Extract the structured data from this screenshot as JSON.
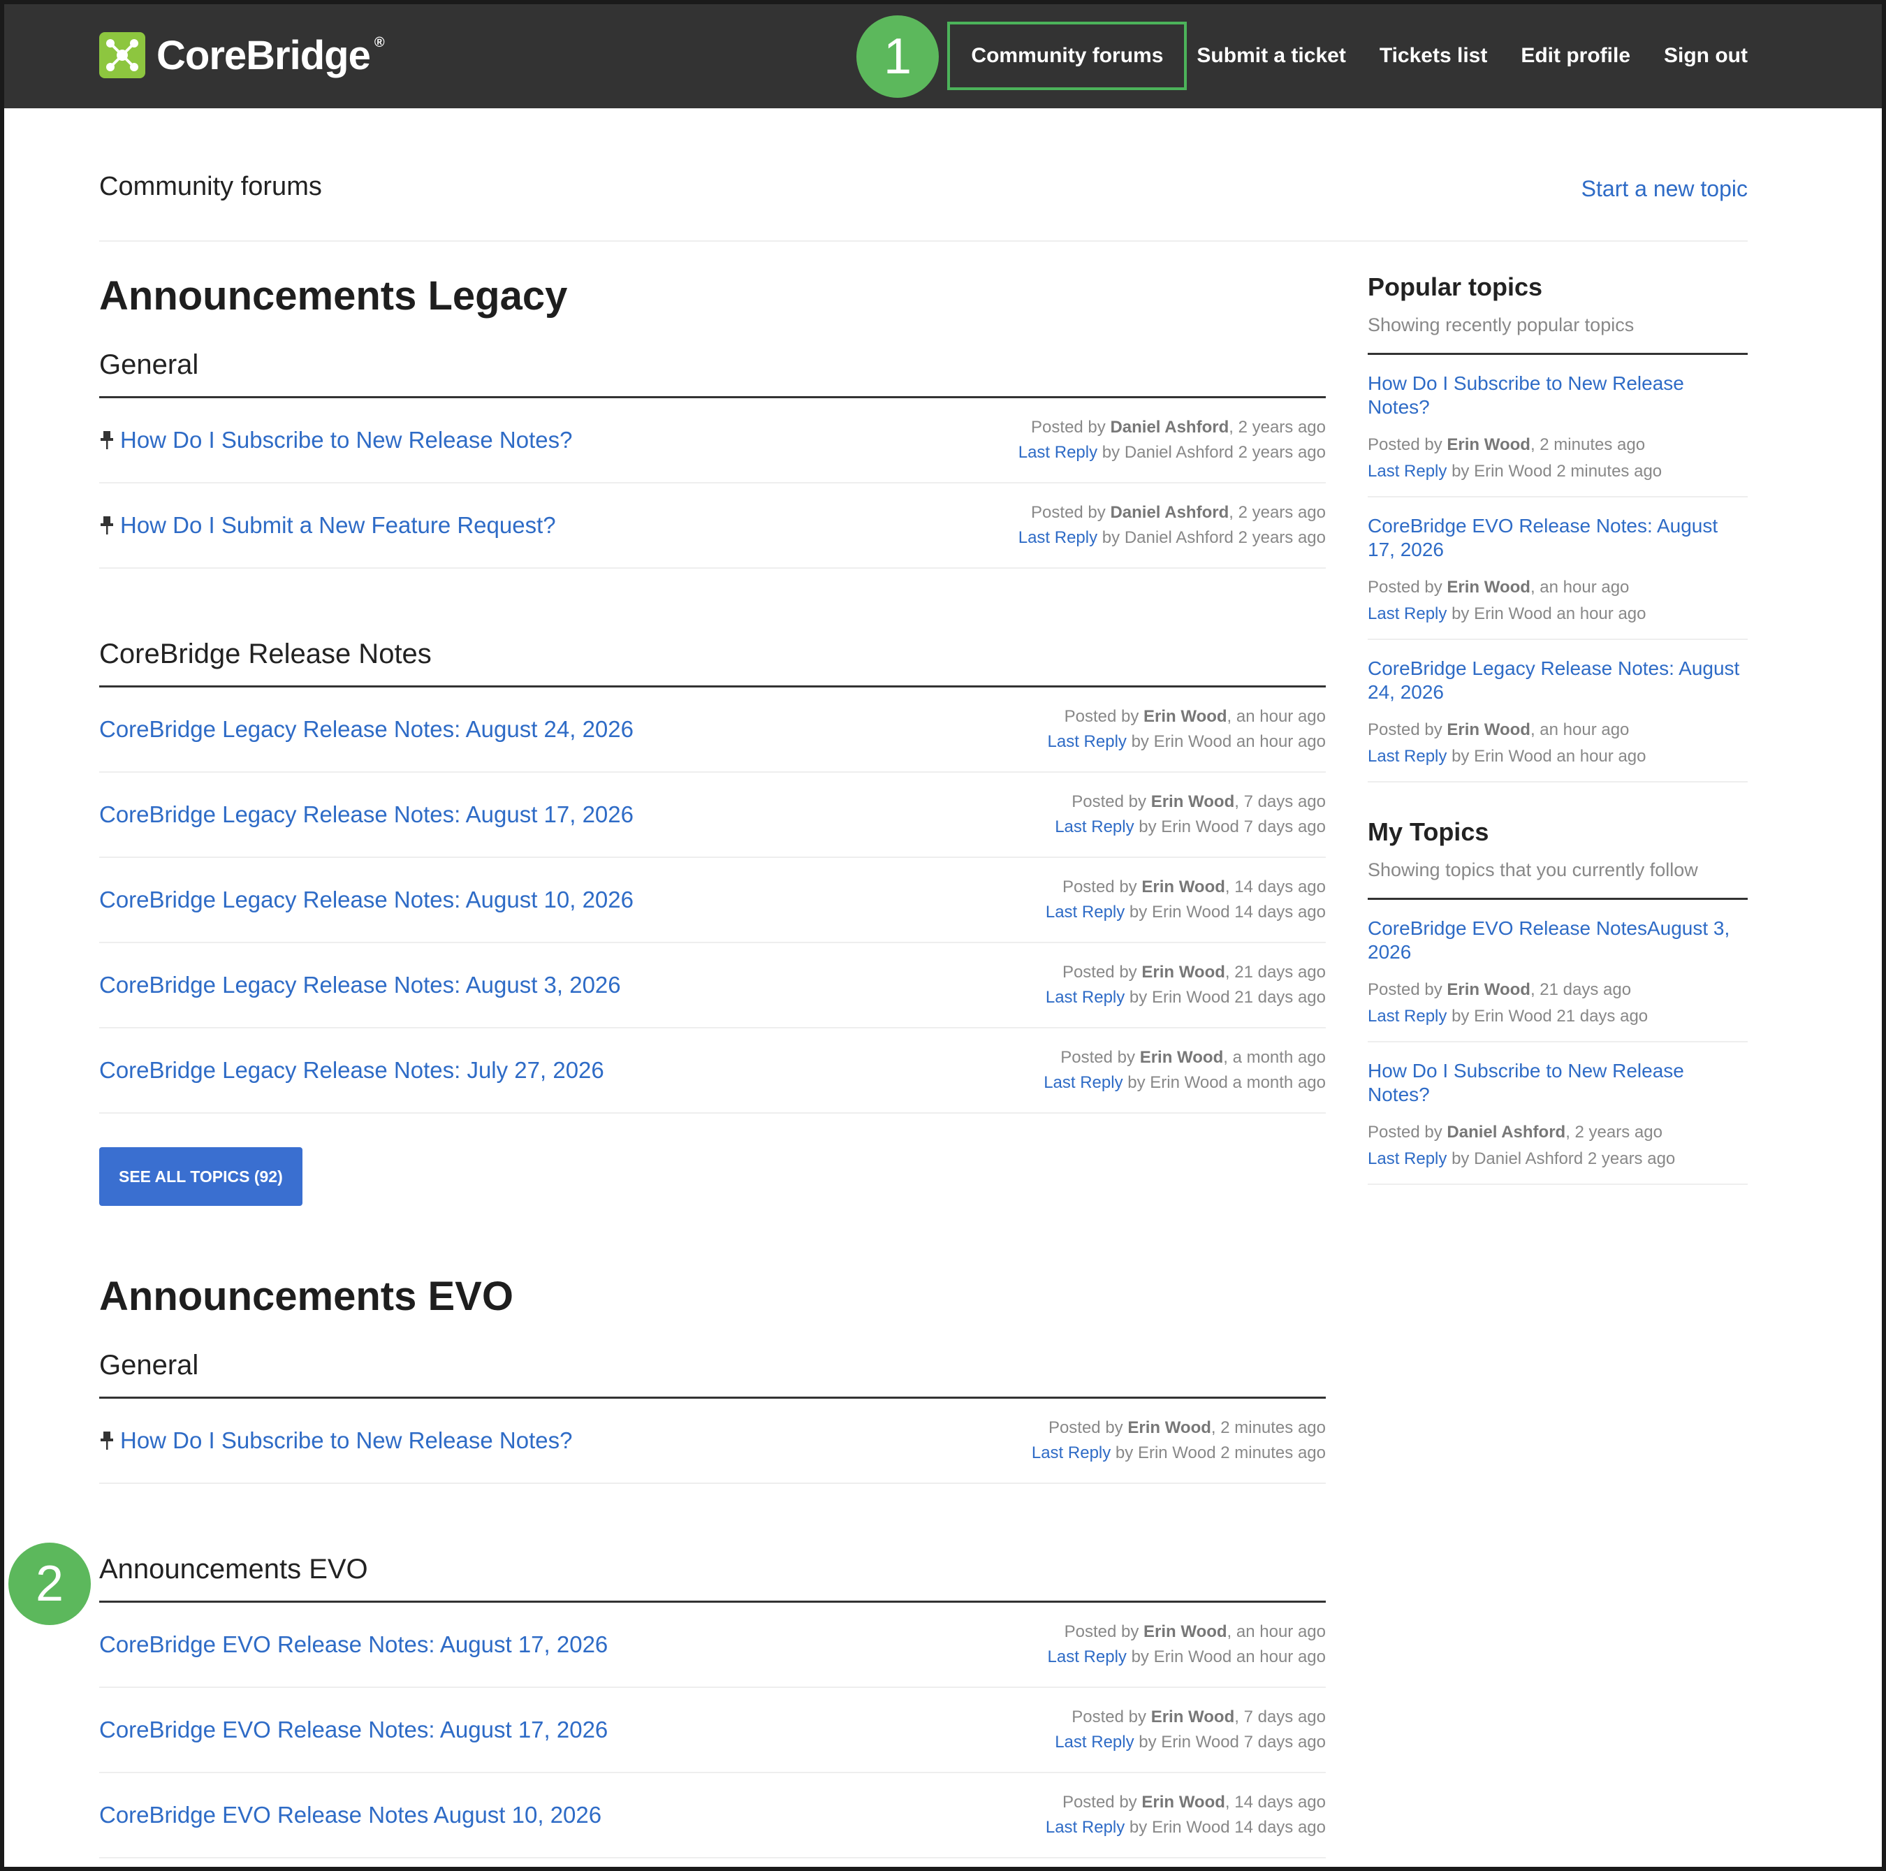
{
  "brand": {
    "name": "CoreBridge",
    "reg": "®",
    "accent": "#8dc63f"
  },
  "nav": {
    "items": [
      "Community forums",
      "Submit a ticket",
      "Tickets list",
      "Edit profile",
      "Sign out"
    ]
  },
  "callouts": [
    "1",
    "2"
  ],
  "page": {
    "title": "Community forums",
    "new_topic": "Start a new topic"
  },
  "labels": {
    "posted_by": "Posted by",
    "last_reply": "Last Reply",
    "by": "by"
  },
  "sections": [
    {
      "title": "Announcements Legacy",
      "categories": [
        {
          "title": "General",
          "rows": [
            {
              "pinned": true,
              "title": "How Do I Subscribe to New Release Notes?",
              "author": "Daniel Ashford",
              "posted": ", 2 years ago",
              "reply": "Daniel Ashford 2 years ago"
            },
            {
              "pinned": true,
              "title": "How Do I Submit a New Feature Request?",
              "author": "Daniel Ashford",
              "posted": ", 2 years ago",
              "reply": "Daniel Ashford 2 years ago"
            }
          ]
        },
        {
          "title": "CoreBridge Release Notes",
          "rows": [
            {
              "pinned": false,
              "title": "CoreBridge Legacy Release Notes: August 24, 2026",
              "author": "Erin Wood",
              "posted": ", an hour ago",
              "reply": "Erin Wood an hour ago"
            },
            {
              "pinned": false,
              "title": "CoreBridge Legacy Release Notes: August 17, 2026",
              "author": "Erin Wood",
              "posted": ", 7 days ago",
              "reply": "Erin Wood 7 days ago"
            },
            {
              "pinned": false,
              "title": "CoreBridge Legacy Release Notes: August 10, 2026",
              "author": "Erin Wood",
              "posted": ", 14 days ago",
              "reply": "Erin Wood 14 days ago"
            },
            {
              "pinned": false,
              "title": "CoreBridge Legacy Release Notes: August 3, 2026",
              "author": "Erin Wood",
              "posted": ", 21 days ago",
              "reply": "Erin Wood 21 days ago"
            },
            {
              "pinned": false,
              "title": "CoreBridge Legacy Release Notes: July 27, 2026",
              "author": "Erin Wood",
              "posted": ", a month ago",
              "reply": "Erin Wood a month ago"
            }
          ],
          "see_all": "SEE ALL TOPICS (92)"
        }
      ]
    },
    {
      "title": "Announcements EVO",
      "categories": [
        {
          "title": "General",
          "rows": [
            {
              "pinned": true,
              "title": "How Do I Subscribe to New Release Notes?",
              "author": "Erin Wood",
              "posted": ", 2 minutes ago",
              "reply": "Erin Wood 2 minutes ago"
            }
          ]
        },
        {
          "title": "Announcements EVO",
          "rows": [
            {
              "pinned": false,
              "title": "CoreBridge EVO Release Notes: August 17, 2026",
              "author": "Erin Wood",
              "posted": ", an hour ago",
              "reply": "Erin Wood an hour ago"
            },
            {
              "pinned": false,
              "title": "CoreBridge EVO Release Notes: August 17, 2026",
              "author": "Erin Wood",
              "posted": ", 7 days ago",
              "reply": "Erin Wood 7 days ago"
            },
            {
              "pinned": false,
              "title": "CoreBridge EVO Release Notes August 10, 2026",
              "author": "Erin Wood",
              "posted": ", 14 days ago",
              "reply": "Erin Wood 14 days ago"
            }
          ]
        }
      ]
    }
  ],
  "sidebar": {
    "popular": {
      "title": "Popular topics",
      "subtitle": "Showing recently popular topics",
      "items": [
        {
          "title": "How Do I Subscribe to New Release Notes?",
          "author": "Erin Wood",
          "posted": ", 2 minutes ago",
          "reply": "Erin Wood 2 minutes ago"
        },
        {
          "title": "CoreBridge EVO Release Notes: August 17, 2026",
          "author": "Erin Wood",
          "posted": ", an hour ago",
          "reply": "Erin Wood an hour ago"
        },
        {
          "title": "CoreBridge Legacy Release Notes: August 24, 2026",
          "author": "Erin Wood",
          "posted": ", an hour ago",
          "reply": "Erin Wood an hour ago"
        }
      ]
    },
    "mine": {
      "title": "My Topics",
      "subtitle": "Showing topics that you currently follow",
      "items": [
        {
          "title": "CoreBridge EVO Release NotesAugust 3, 2026",
          "author": "Erin Wood",
          "posted": ", 21 days ago",
          "reply": "Erin Wood 21 days ago"
        },
        {
          "title": "How Do I Subscribe to New Release Notes?",
          "author": "Daniel Ashford",
          "posted": ", 2 years ago",
          "reply": "Daniel Ashford 2 years ago"
        }
      ]
    }
  }
}
